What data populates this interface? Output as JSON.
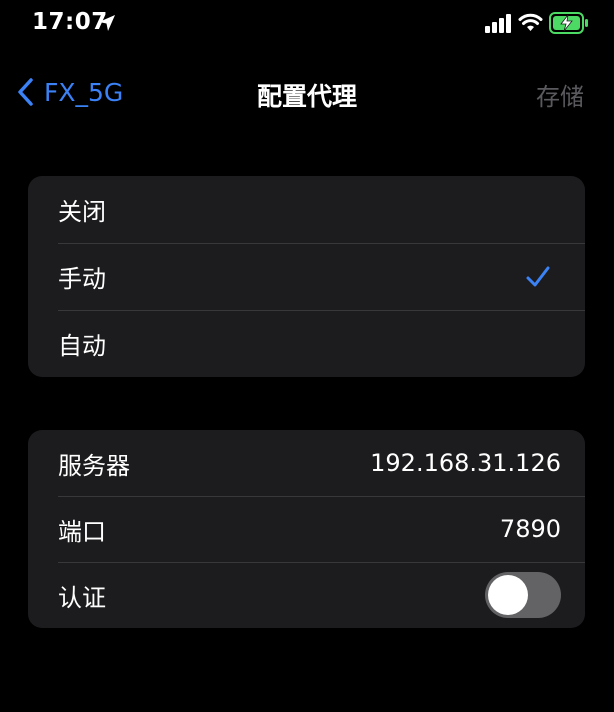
{
  "status_bar": {
    "time": "17:07",
    "icons": [
      "location-arrow-icon",
      "cellular-signal-icon",
      "wifi-icon",
      "battery-charging-icon"
    ],
    "battery_color": "#4cd964"
  },
  "nav": {
    "back_label": "FX_5G",
    "title": "配置代理",
    "save_label": "存储",
    "accent_color": "#3b82f6"
  },
  "proxy_modes": [
    {
      "label": "关闭",
      "selected": false
    },
    {
      "label": "手动",
      "selected": true
    },
    {
      "label": "自动",
      "selected": false
    }
  ],
  "manual_settings": {
    "server": {
      "label": "服务器",
      "value": "192.168.31.126"
    },
    "port": {
      "label": "端口",
      "value": "7890"
    },
    "auth": {
      "label": "认证",
      "enabled": false
    }
  }
}
